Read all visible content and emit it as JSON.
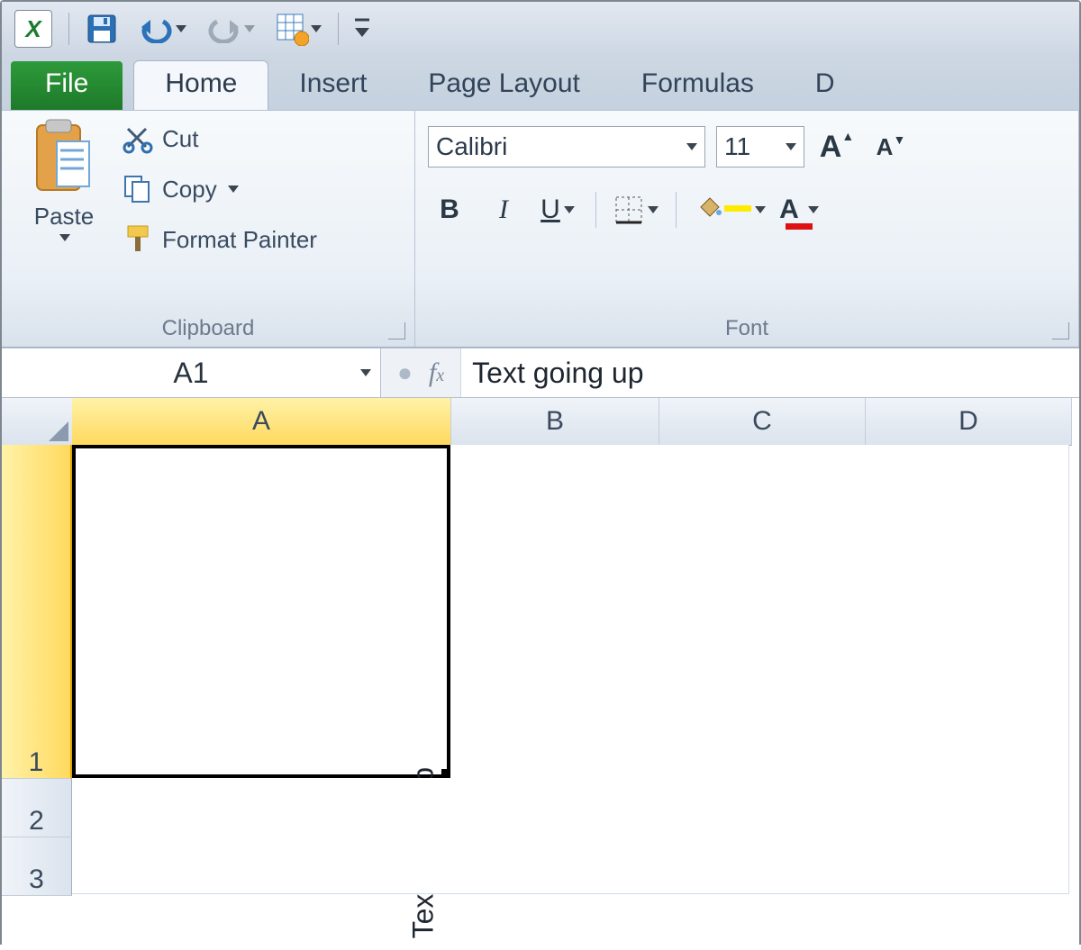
{
  "tabs": {
    "file": "File",
    "home": "Home",
    "insert": "Insert",
    "page_layout": "Page Layout",
    "formulas": "Formulas",
    "data_initial": "D"
  },
  "clipboard": {
    "paste": "Paste",
    "cut": "Cut",
    "copy": "Copy",
    "format_painter": "Format Painter",
    "group_label": "Clipboard"
  },
  "font": {
    "name": "Calibri",
    "size": "11",
    "group_label": "Font",
    "bold": "B",
    "italic": "I",
    "underline": "U"
  },
  "namebox": "A1",
  "formula_value": "Text going up",
  "columns": [
    "A",
    "B",
    "C",
    "D"
  ],
  "rows": [
    "1",
    "2",
    "3"
  ],
  "cell_a1": "Text going up",
  "selected_cell": "A1"
}
